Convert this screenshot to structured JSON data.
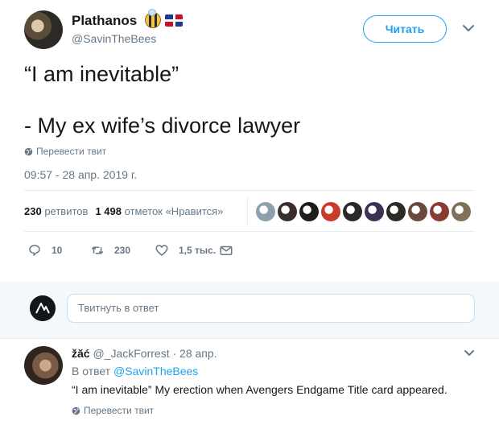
{
  "tweet": {
    "author_name": "Plathanos",
    "author_emoji": [
      "bee-icon",
      "dominican-flag-icon"
    ],
    "author_handle": "@SavinTheBees",
    "follow_label": "Читать",
    "text_line1": "“I am inevitable”",
    "text_line2": "- My ex wife’s divorce lawyer",
    "translate_label": "Перевести твит",
    "timestamp": "09:57 - 28 апр. 2019 г.",
    "retweets_count": "230",
    "retweets_label": "ретвитов",
    "likes_count": "1 498",
    "likes_label": "отметок «Нравится»",
    "liker_avatar_colors": [
      "#8fa0ad",
      "#3a2f2b",
      "#1f1d1c",
      "#c83a2a",
      "#2c2a28",
      "#3f2f55",
      "#2b2a26",
      "#6a4a3c",
      "#8a3a32",
      "#7f7258"
    ]
  },
  "actions": {
    "reply_count": "10",
    "retweet_count": "230",
    "like_count": "1,5 тыс."
  },
  "composer": {
    "placeholder": "Твитнуть в ответ"
  },
  "reply": {
    "author_name": "žăć",
    "author_handle": "@_JackForrest",
    "date": "· 28 апр.",
    "reply_to_prefix": "В ответ",
    "reply_to_mention": "@SavinTheBees",
    "text": "“I am inevitable” My erection when Avengers Endgame Title card appeared.",
    "translate_label": "Перевести твит"
  },
  "colors": {
    "accent": "#1da1f2",
    "secondary_text": "#657786",
    "primary_text": "#14171a",
    "like_color": "#e0245e"
  }
}
